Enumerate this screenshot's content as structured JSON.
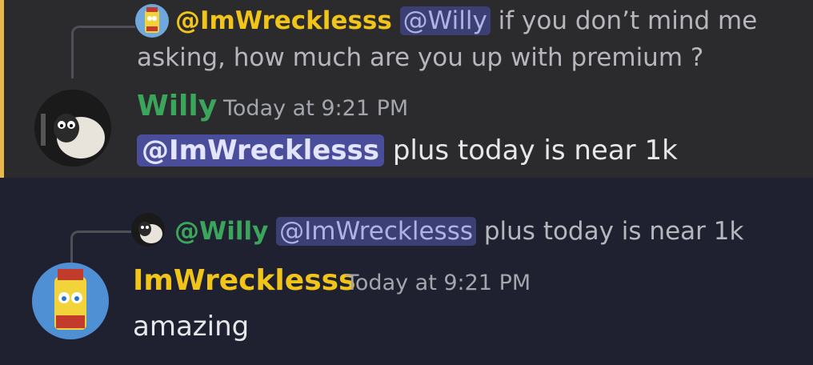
{
  "messages": [
    {
      "reply": {
        "author": "@ImWrecklesss",
        "mention": "@Willy",
        "line1": " if you don’t mind me",
        "line2": "asking, how much are you up with premium ?"
      },
      "username": "Willy",
      "username_color": "#3ba55c",
      "timestamp": "Today at 9:21 PM",
      "mention": "@ImWrecklesss",
      "text": " plus today is near 1k"
    },
    {
      "reply": {
        "author": "@Willy",
        "mention": "@ImWrecklesss",
        "text": " plus today is near 1k"
      },
      "username": "ImWrecklesss",
      "username_color": "#f0c419",
      "timestamp": "Today at 9:21 PM",
      "text": "amazing"
    }
  ],
  "colors": {
    "highlight_bar": "#e8b84a",
    "mention_bg": "#3c3f8a"
  },
  "icons": {
    "willy_avatar": "sheep-avatar-icon",
    "wreckless_avatar": "sponge-mustard-avatar-icon"
  }
}
